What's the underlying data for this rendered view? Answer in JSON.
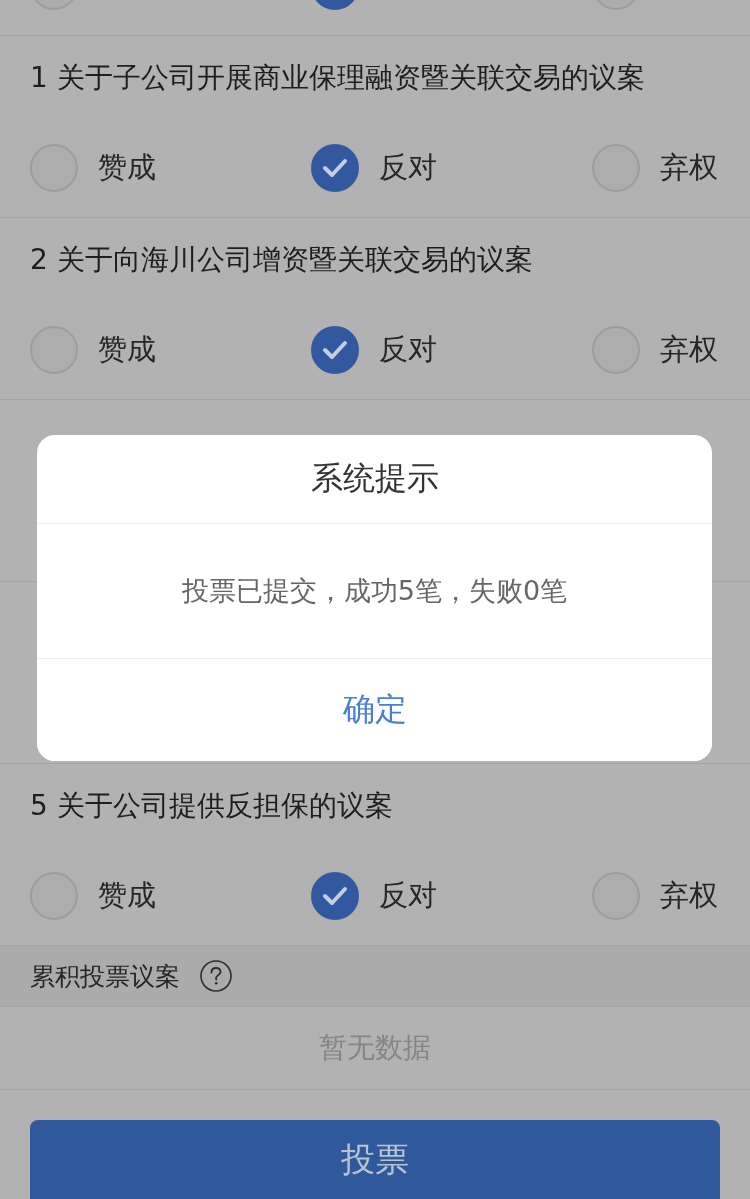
{
  "previous_item_options": [
    {
      "selected": false
    },
    {
      "selected": true
    },
    {
      "selected": false
    }
  ],
  "items_above_dialog": [
    {
      "title": "1 关于子公司开展商业保理融资暨关联交易的议案",
      "options": [
        {
          "label": "赞成",
          "selected": false
        },
        {
          "label": "反对",
          "selected": true
        },
        {
          "label": "弃权",
          "selected": false
        }
      ]
    },
    {
      "title": "2 关于向海川公司增资暨关联交易的议案",
      "options": [
        {
          "label": "赞成",
          "selected": false
        },
        {
          "label": "反对",
          "selected": true
        },
        {
          "label": "弃权",
          "selected": false
        }
      ]
    }
  ],
  "dialog": {
    "title": "系统提示",
    "message": "投票已提交，成功5笔，失败0笔",
    "confirm_button": "确定"
  },
  "items_below_dialog": [
    {
      "title": "5 关于公司提供反担保的议案",
      "options": [
        {
          "label": "赞成",
          "selected": false
        },
        {
          "label": "反对",
          "selected": true
        },
        {
          "label": "弃权",
          "selected": false
        }
      ]
    }
  ],
  "cumulative_section": {
    "title": "累积投票议案",
    "empty_text": "暂无数据"
  },
  "vote_button": "投票"
}
